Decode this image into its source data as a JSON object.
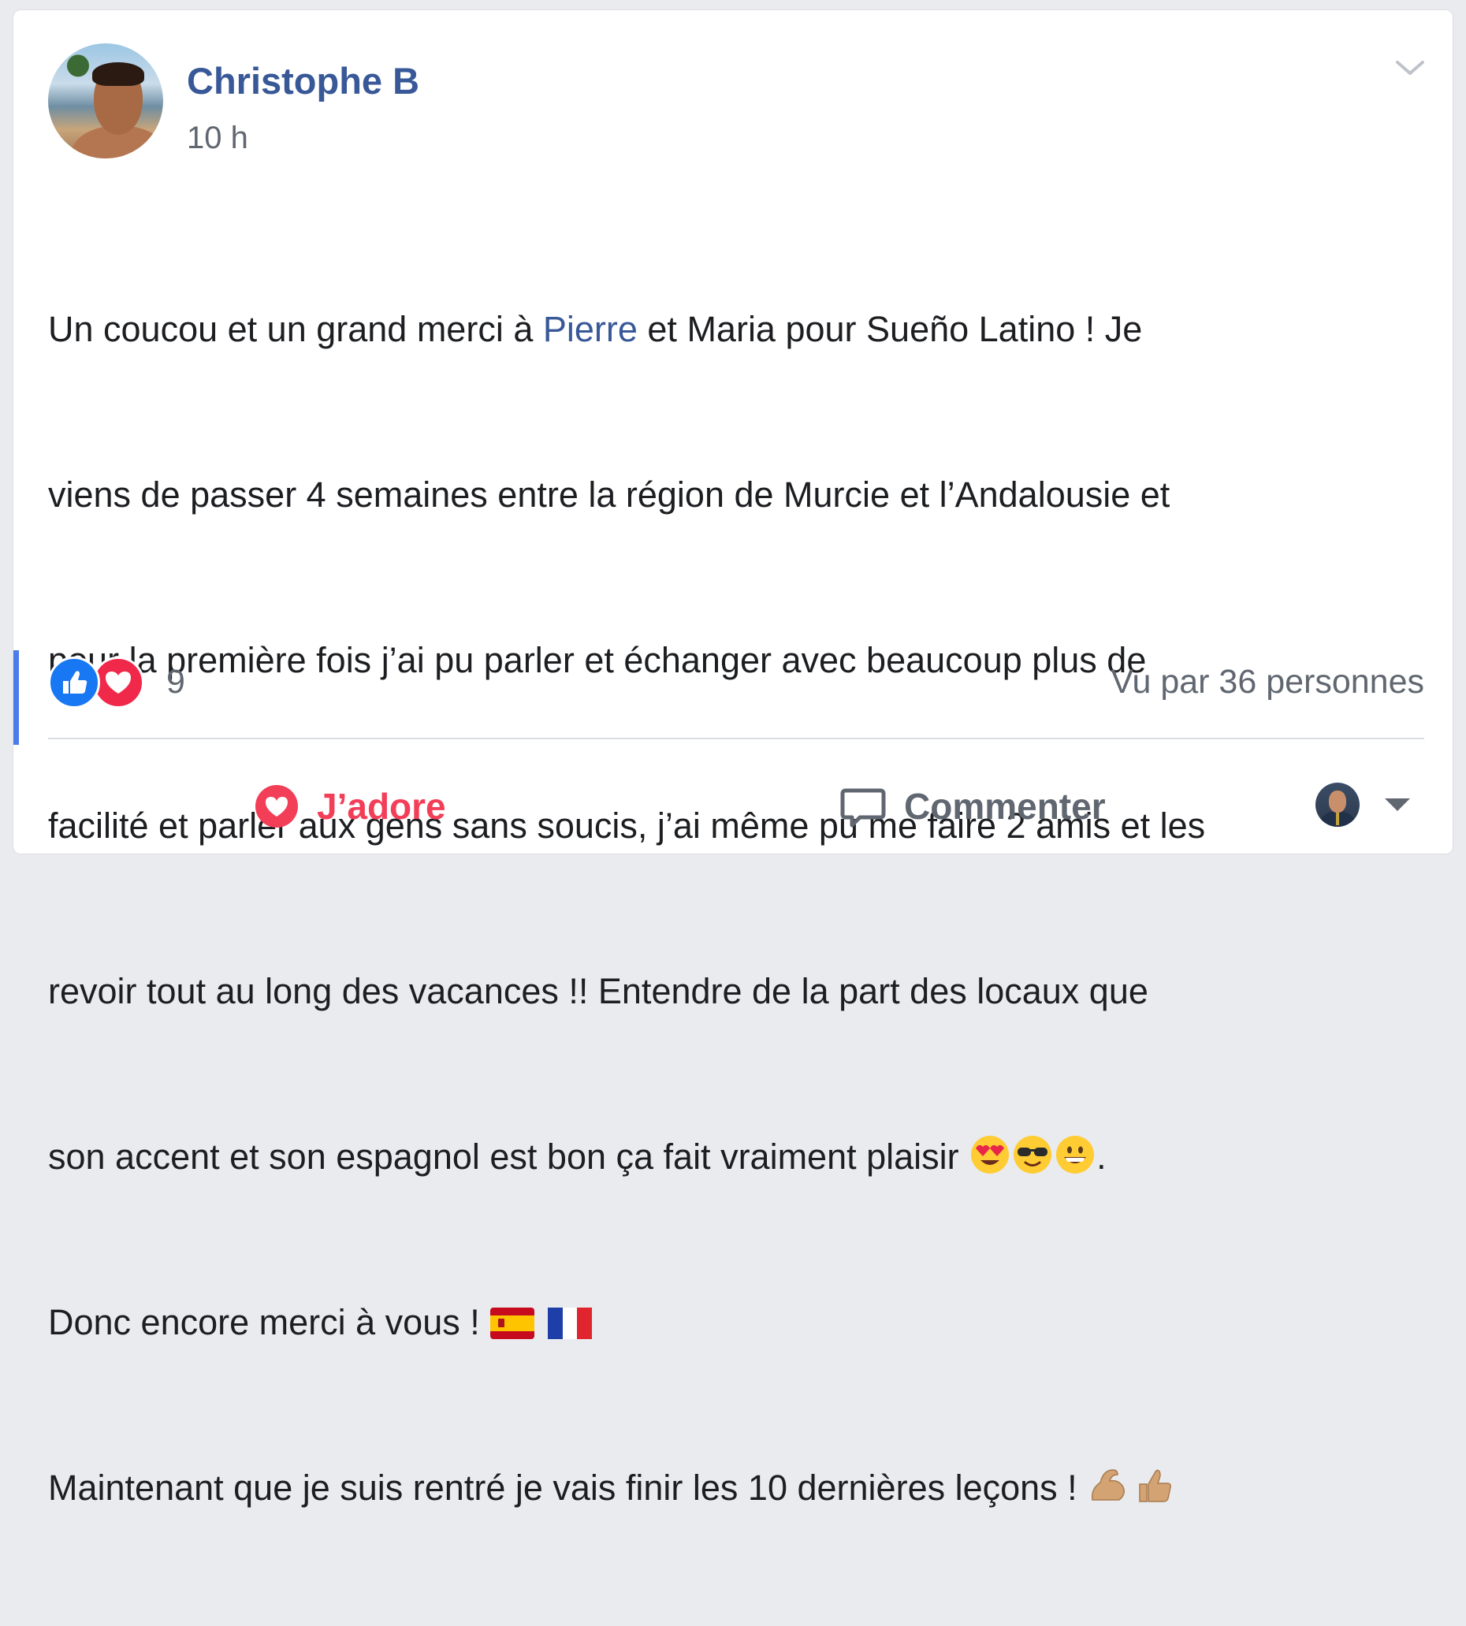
{
  "post": {
    "author": "Christophe B",
    "time": "10 h",
    "lines": {
      "l1_before": "Un coucou et un grand merci à ",
      "l1_mention": "Pierre",
      "l1_after": " et Maria pour Sueño Latino ! Je",
      "l2": "viens de passer 4 semaines entre la région de Murcie et l’Andalousie et",
      "l3": "pour la première fois j’ai pu parler et échanger avec beaucoup plus de",
      "l4": "facilité et parler aux gens sans soucis, j’ai même pu me faire 2 amis et les",
      "l5": "revoir tout au long des vacances !! Entendre de la part des locaux que",
      "l6_text": "son accent et son espagnol est bon ça fait vraiment plaisir ",
      "l6_end": ".",
      "l7_text": "Donc encore merci à vous ! ",
      "l8_text": "Maintenant que je suis rentré je vais finir les 10 dernières leçons ! "
    },
    "emojis": [
      "heart-eyes-emoji",
      "sunglasses-emoji",
      "grinning-emoji",
      "spain-flag-emoji",
      "france-flag-emoji",
      "flexed-biceps-emoji",
      "thumbs-up-emoji"
    ]
  },
  "reactions": {
    "types": [
      "like",
      "love"
    ],
    "count": "9"
  },
  "seen_by": "Vu par 36 personnes",
  "actions": {
    "love_label": "J’adore",
    "comment_label": "Commenter"
  },
  "colors": {
    "link": "#385898",
    "love": "#f33e58",
    "like": "#1877f2",
    "muted": "#606770"
  }
}
